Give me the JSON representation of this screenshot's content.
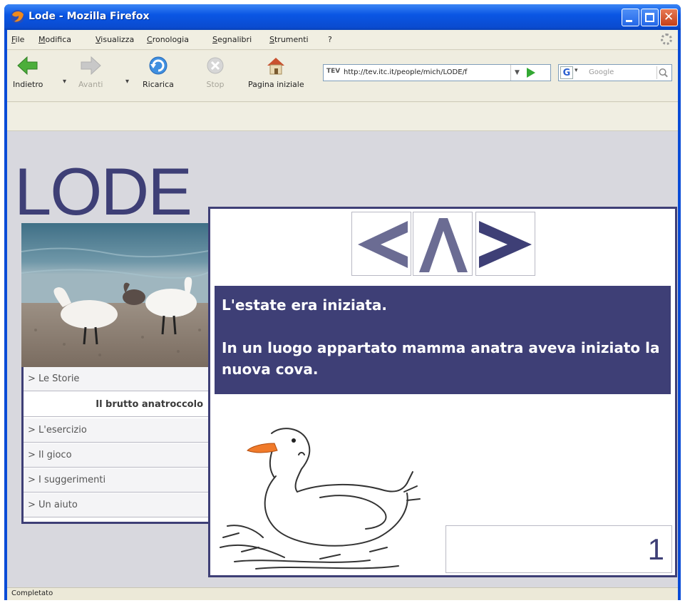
{
  "window": {
    "title": "Lode - Mozilla Firefox"
  },
  "menu": [
    "File",
    "Modifica",
    "Visualizza",
    "Cronologia",
    "Segnalibri",
    "Strumenti",
    "?"
  ],
  "toolbar": {
    "back": "Indietro",
    "forward": "Avanti",
    "reload": "Ricarica",
    "stop": "Stop",
    "home": "Pagina iniziale"
  },
  "address": {
    "url": "http://tev.itc.it/people/mich/LODE/f",
    "site_icon_label": "TEV"
  },
  "search": {
    "engine": "G",
    "placeholder": "Google"
  },
  "page": {
    "logo": "LODE",
    "nav": [
      {
        "label": "> Le Storie"
      },
      {
        "label": "Il brutto anatroccolo"
      },
      {
        "label": "> L'esercizio"
      },
      {
        "label": "> Il gioco"
      },
      {
        "label": "> I suggerimenti"
      },
      {
        "label": "> Un aiuto"
      }
    ],
    "story": {
      "line1": "L'estate era iniziata.",
      "line2": "In un luogo appartato mamma anatra aveva iniziato la nuova cova."
    },
    "page_number": "1"
  },
  "status": {
    "text": "Completato"
  },
  "colors": {
    "brand": "#3e3f76",
    "xp_blue": "#0a4cd6"
  },
  "icons": {
    "back": "back-arrow-icon",
    "forward": "forward-arrow-icon",
    "reload": "reload-icon",
    "stop": "stop-icon",
    "home": "home-icon",
    "prev": "previous-page-icon",
    "up": "up-level-icon",
    "next": "next-page-icon"
  }
}
